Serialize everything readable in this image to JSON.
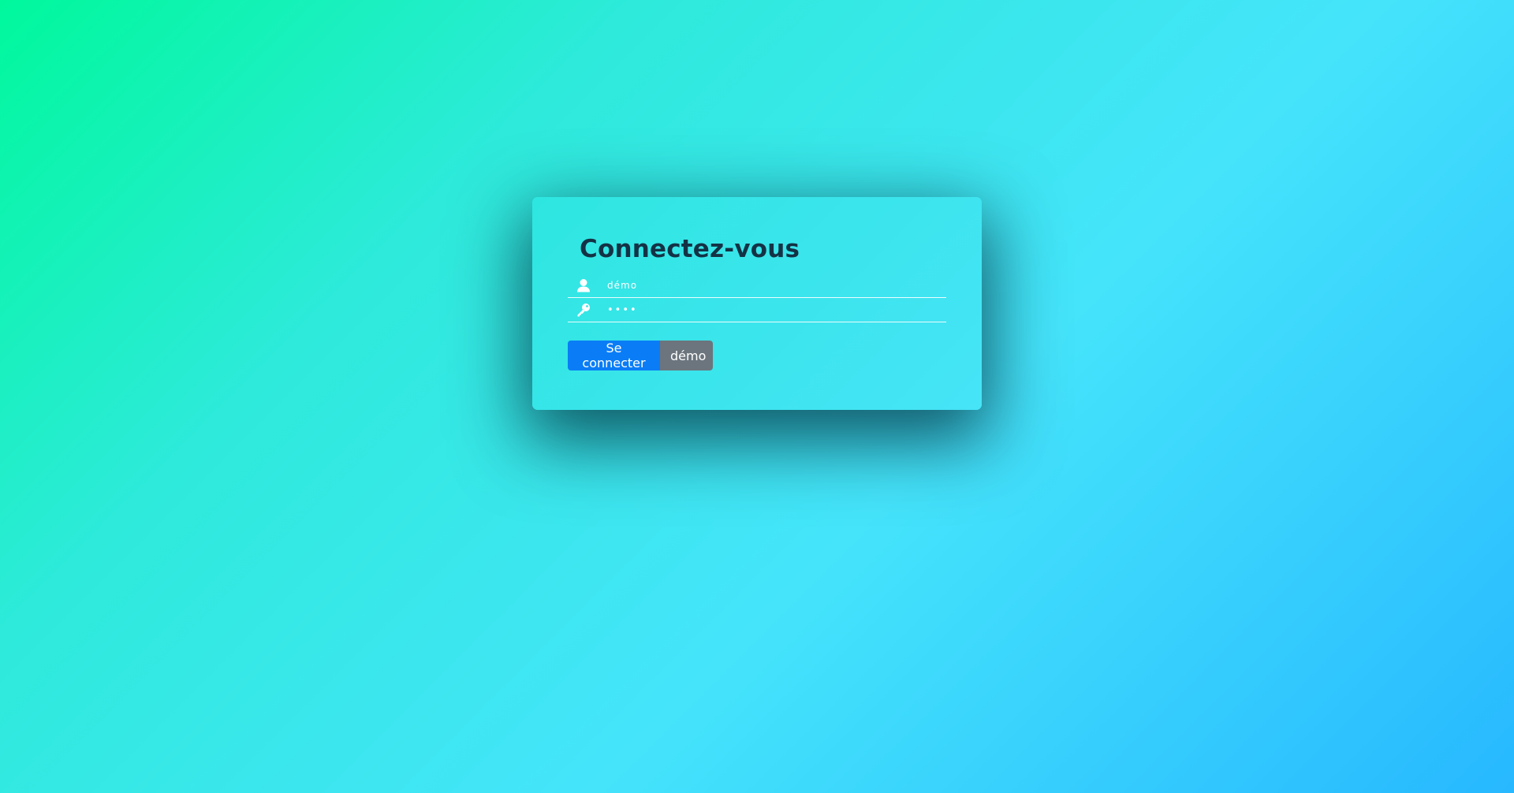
{
  "login": {
    "title": "Connectez-vous",
    "username": {
      "value": "démo",
      "icon": "user-icon"
    },
    "password": {
      "value": "démo",
      "icon": "key-icon"
    },
    "buttons": {
      "submit_label": "Se connecter",
      "demo_label": "démo"
    }
  },
  "colors": {
    "primary_button": "#0a7df6",
    "secondary_button": "#6c757d",
    "title_text": "#143245"
  }
}
